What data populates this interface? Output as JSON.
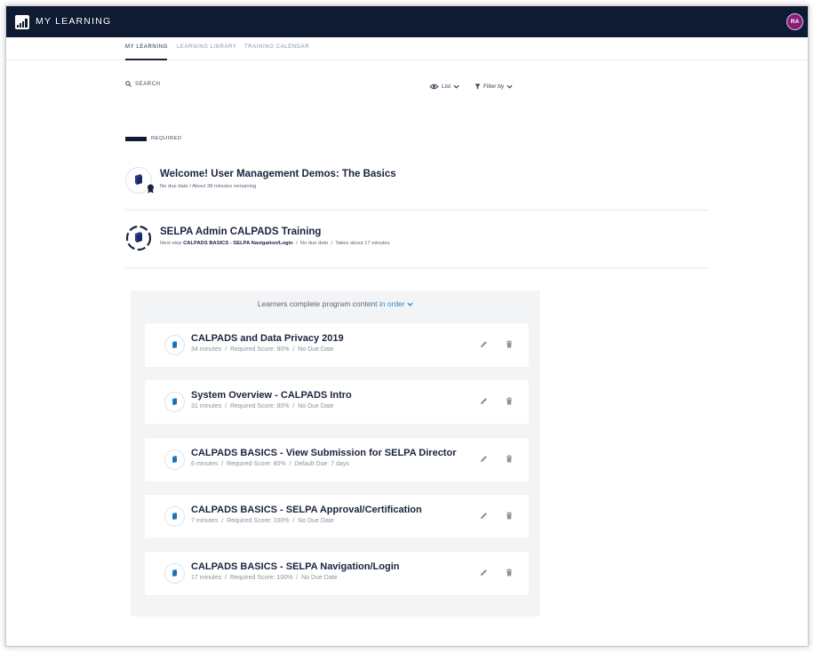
{
  "header": {
    "app_title": "MY LEARNING",
    "avatar_initials": "RA"
  },
  "tabs": [
    {
      "label": "MY LEARNING",
      "active": true
    },
    {
      "label": "LEARNING LIBRARY",
      "active": false
    },
    {
      "label": "TRAINING CALENDAR",
      "active": false
    }
  ],
  "toolbar": {
    "search_label": "SEARCH",
    "view_label": "List",
    "filter_label": "Filter by"
  },
  "section_label": "REQUIRED",
  "courses": [
    {
      "title": "Welcome! User Management Demos: The Basics",
      "meta": "No due date  /  About 38 minutes remaining"
    },
    {
      "title": "SELPA Admin CALPADS Training",
      "next_step_prefix": "Next step",
      "next_step_name": "CALPADS BASICS - SELPA Navigation/Login",
      "meta_rest": "  /  No due date  /  Takes about 17 minutes"
    }
  ],
  "program": {
    "order_prefix": "Learners complete program content",
    "order_link": "in order",
    "items": [
      {
        "title": "CALPADS and Data Privacy 2019",
        "meta": "34 minutes  /  Required Score: 80%  /  No Due Date"
      },
      {
        "title": "System Overview - CALPADS Intro",
        "meta": "31 minutes  /  Required Score: 80%  /  No Due Date"
      },
      {
        "title": "CALPADS BASICS - View Submission for SELPA Director",
        "meta": "6 minutes  /  Required Score: 80%  /  Default Due: 7 days"
      },
      {
        "title": "CALPADS BASICS - SELPA Approval/Certification",
        "meta": "7 minutes  /  Required Score: 100%  /  No Due Date"
      },
      {
        "title": "CALPADS BASICS - SELPA Navigation/Login",
        "meta": "17 minutes  /  Required Score: 100%  /  No Due Date"
      }
    ]
  },
  "colors": {
    "navy": "#0f1a33",
    "accent_blue": "#2a8ad6",
    "avatar": "#8a1f7a"
  }
}
